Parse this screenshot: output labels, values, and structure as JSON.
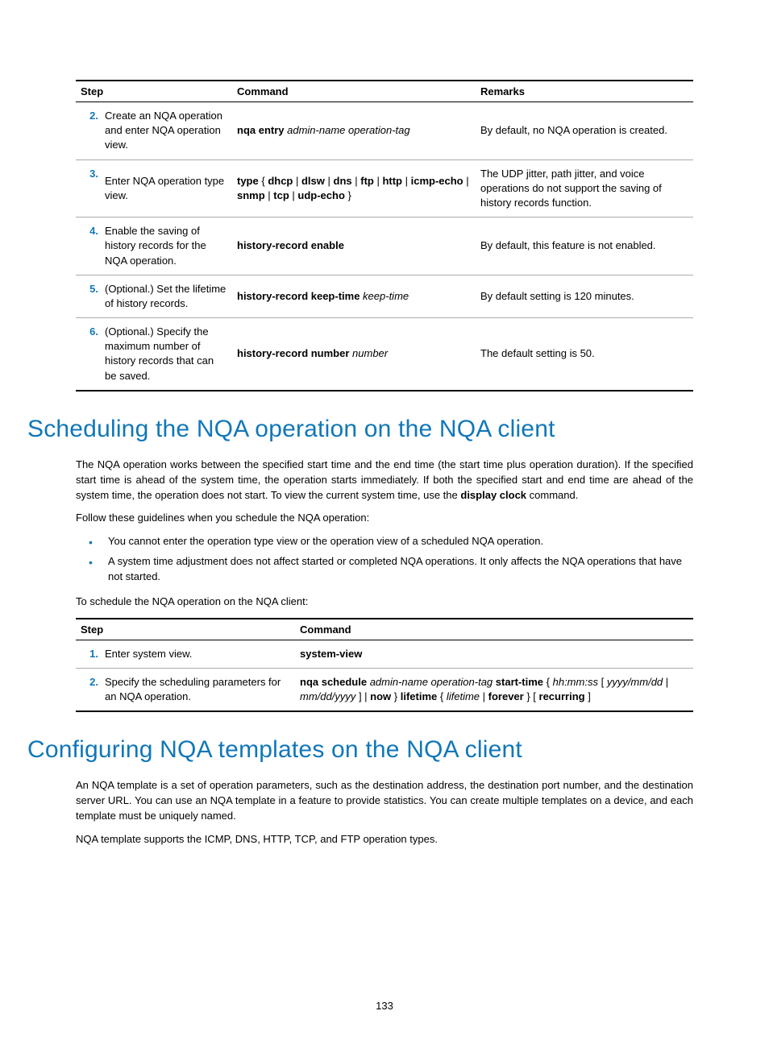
{
  "page_number": "133",
  "table1": {
    "headers": {
      "step": "Step",
      "command": "Command",
      "remarks": "Remarks"
    },
    "rows": [
      {
        "num": "2.",
        "desc": "Create an NQA operation and enter NQA operation view.",
        "cmd_pre_b": "nqa entry",
        "cmd_pre_i": " admin-name operation-tag",
        "remarks": "By default, no NQA operation is created."
      },
      {
        "num": "3.",
        "desc": "Enter NQA operation type view.",
        "cmd_html_parts": [
          "type",
          " { ",
          "dhcp",
          " | ",
          "dlsw",
          " | ",
          "dns",
          " | ",
          "ftp",
          " | ",
          "http",
          " | ",
          "icmp-echo",
          " | ",
          "snmp",
          " | ",
          "tcp",
          " | ",
          "udp-echo",
          " }"
        ],
        "remarks": "The UDP jitter, path jitter, and voice operations do not support the saving of history records function."
      },
      {
        "num": "4.",
        "desc": "Enable the saving of history records for the NQA operation.",
        "cmd_pre_b": "history-record enable",
        "remarks": "By default, this feature is not enabled."
      },
      {
        "num": "5.",
        "desc": "(Optional.) Set the lifetime of history records.",
        "cmd_pre_b": "history-record keep-time",
        "cmd_pre_i": " keep-time",
        "remarks": "By default setting is 120 minutes."
      },
      {
        "num": "6.",
        "desc": "(Optional.) Specify the maximum number of history records that can be saved.",
        "cmd_pre_b": "history-record number",
        "cmd_pre_i": " number",
        "remarks": "The default setting is 50."
      }
    ]
  },
  "h1_scheduling": "Scheduling the NQA operation on the NQA client",
  "p_sched_1a": "The NQA operation works between the specified start time and the end time (the start time plus operation duration). If the specified start time is ahead of the system time, the operation starts immediately. If both the specified start and end time are ahead of the system time, the operation does not start. To view the current system time, use the ",
  "p_sched_1_bold": "display clock",
  "p_sched_1b": " command.",
  "p_sched_2": "Follow these guidelines when you schedule the NQA operation:",
  "bullets": [
    "You cannot enter the operation type view or the operation view of a scheduled NQA operation.",
    "A system time adjustment does not affect started or completed NQA operations. It only affects the NQA operations that have not started."
  ],
  "p_sched_3": "To schedule the NQA operation on the NQA client:",
  "table2": {
    "headers": {
      "step": "Step",
      "command": "Command"
    },
    "rows": [
      {
        "num": "1.",
        "desc": "Enter system view.",
        "cmd_b": "system-view"
      },
      {
        "num": "2.",
        "desc": "Specify the scheduling parameters for an NQA operation.",
        "cmd_parts": {
          "b1": "nqa schedule",
          "i1": " admin-name operation-tag ",
          "b2": "start-time",
          "t1": " { ",
          "i2": "hh:mm:ss ",
          "t2": "[ ",
          "i3": "yyyy/mm/dd",
          "t3": " | ",
          "i4": "mm/dd/yyyy",
          "t4": " ] | ",
          "b3": "now",
          "t5": " } ",
          "b4": "lifetime",
          "t6": " { ",
          "i5": "lifetime",
          "t7": " | ",
          "b5": "forever",
          "t8": " } [ ",
          "b6": "recurring",
          "t9": " ]"
        }
      }
    ]
  },
  "h1_templates": "Configuring NQA templates on the NQA client",
  "p_tpl_1": "An NQA template is a set of operation parameters, such as the destination address, the destination port number, and the destination server URL. You can use an NQA template in a feature to provide statistics. You can create multiple templates on a device, and each template must be uniquely named.",
  "p_tpl_2": "NQA template supports the ICMP, DNS, HTTP, TCP, and FTP operation types."
}
